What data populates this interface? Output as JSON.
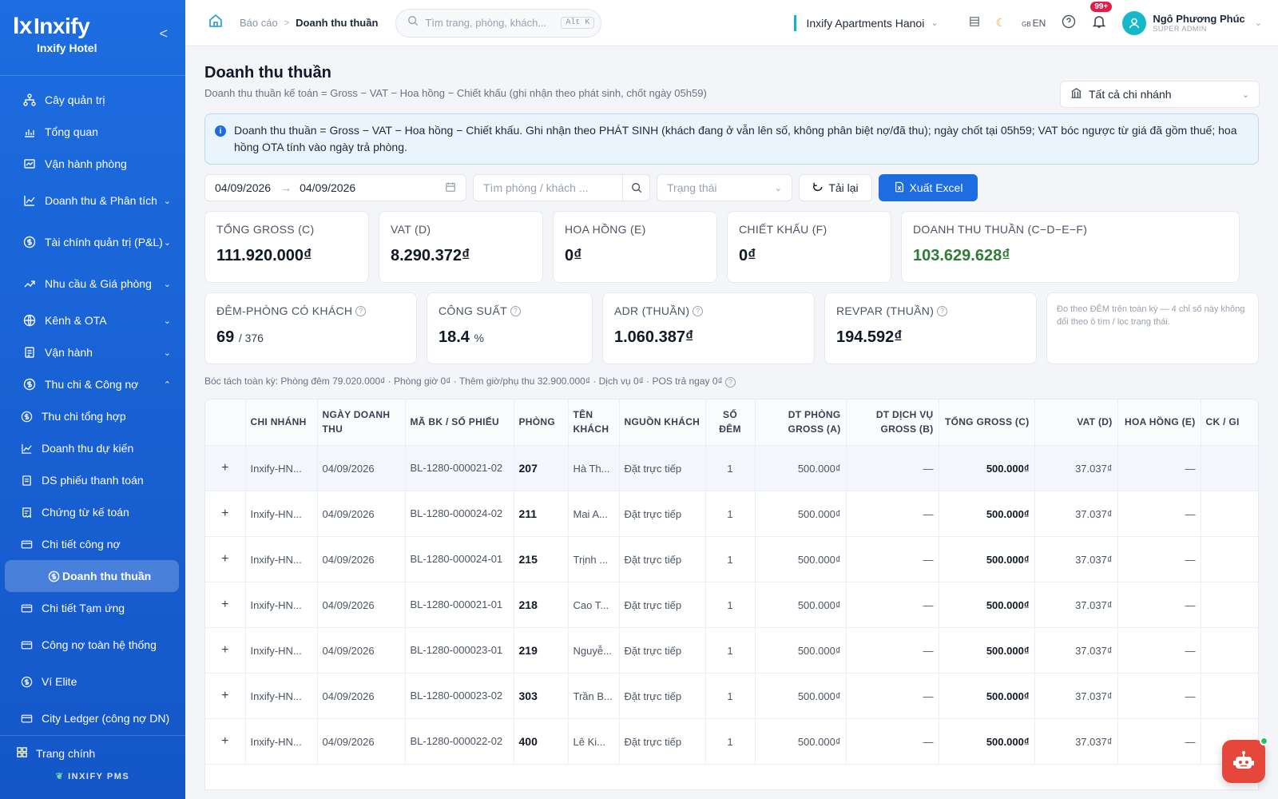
{
  "brand": {
    "name": "Inxify",
    "hotel": "Inxify Hotel",
    "footer": "INXIFY PMS"
  },
  "sidebar": {
    "items": [
      {
        "label": "Cây quản trị",
        "icon": "tree-icon"
      },
      {
        "label": "Tổng quan",
        "icon": "bar-chart-icon"
      },
      {
        "label": "Vận hành phòng",
        "icon": "window-icon"
      },
      {
        "label": "Doanh thu & Phân tích",
        "icon": "line-chart-icon"
      },
      {
        "label": "Tài chính quản trị (P&L)",
        "icon": "dollar-icon"
      },
      {
        "label": "Nhu cầu & Giá phòng",
        "icon": "trend-icon"
      },
      {
        "label": "Kênh & OTA",
        "icon": "globe-icon"
      },
      {
        "label": "Vận hành",
        "icon": "clipboard-icon"
      },
      {
        "label": "Thu chi & Công nợ",
        "icon": "dollar-icon"
      }
    ],
    "subitems": [
      {
        "label": "Thu chi tổng hợp"
      },
      {
        "label": "Doanh thu dự kiến"
      },
      {
        "label": "DS phiếu thanh toán"
      },
      {
        "label": "Chứng từ kế toán"
      },
      {
        "label": "Chi tiết công nợ"
      },
      {
        "label": "Doanh thu thuần"
      },
      {
        "label": "Chi tiết Tạm ứng"
      },
      {
        "label": "Công nợ toàn hệ thống"
      },
      {
        "label": "Ví Elite"
      },
      {
        "label": "City Ledger (công nợ DN)"
      }
    ],
    "home": "Trang chính"
  },
  "topbar": {
    "breadcrumb_parent": "Báo cáo",
    "breadcrumb_current": "Doanh thu thuần",
    "search_placeholder": "Tìm trang, phòng, khách...",
    "search_shortcut": "Alt K",
    "property": "Inxify Apartments Hanoi",
    "lang_flag": "GB",
    "lang": "EN",
    "notif_count": "99+",
    "user_name": "Ngô Phương Phúc",
    "user_role": "SUPER ADMIN"
  },
  "page": {
    "title": "Doanh thu thuần",
    "subtitle": "Doanh thu thuần kế toán = Gross − VAT − Hoa hồng − Chiết khấu (ghi nhận theo phát sinh, chốt ngày 05h59)",
    "branch_filter": "Tất cả chi nhánh",
    "info": "Doanh thu thuần = Gross − VAT − Hoa hồng − Chiết khấu. Ghi nhận theo PHÁT SINH (khách đang ở vẫn lên số, không phân biệt nợ/đã thu); ngày chốt tại 05h59; VAT bóc ngược từ giá đã gồm thuế; hoa hồng OTA tính vào ngày trả phòng."
  },
  "filters": {
    "date_from": "04/09/2026",
    "date_to": "04/09/2026",
    "search_placeholder": "Tìm phòng / khách ...",
    "status_placeholder": "Trạng thái",
    "reload": "Tải lại",
    "export": "Xuất Excel"
  },
  "kpi_row1": [
    {
      "label": "TỔNG GROSS (C)",
      "value": "111.920.000₫"
    },
    {
      "label": "VAT (D)",
      "value": "8.290.372₫"
    },
    {
      "label": "HOA HỒNG (E)",
      "value": "0₫"
    },
    {
      "label": "CHIẾT KHẤU (F)",
      "value": "0₫"
    },
    {
      "label": "DOANH THU THUẦN (C−D−E−F)",
      "value": "103.629.628₫"
    }
  ],
  "kpi_row2": [
    {
      "label": "ĐÊM-PHÒNG CÓ KHÁCH",
      "value": "69",
      "suffix": "/ 376"
    },
    {
      "label": "CÔNG SUẤT",
      "value": "18.4",
      "suffix": "%"
    },
    {
      "label": "ADR (THUẦN)",
      "value": "1.060.387₫",
      "suffix": ""
    },
    {
      "label": "REVPAR (THUẦN)",
      "value": "194.592₫",
      "suffix": ""
    }
  ],
  "kpi_note": "Đo theo ĐÊM trên toàn kỳ — 4 chỉ số này không đổi theo ô tìm / lọc trạng thái.",
  "breakdown": "Bóc tách toàn kỳ: Phòng đêm 79.020.000₫ · Phòng giờ 0₫ · Thêm giờ/phụ thu 32.900.000₫ · Dịch vụ 0₫ · POS trả ngay 0₫",
  "table": {
    "headers": [
      "CHI NHÁNH",
      "NGÀY DOANH THU",
      "MÃ BK / SỐ PHIẾU",
      "PHÒNG",
      "TÊN KHÁCH",
      "NGUỒN KHÁCH",
      "SỐ ĐÊM",
      "DT PHÒNG GROSS (A)",
      "DT DỊCH VỤ GROSS (B)",
      "TỔNG GROSS (C)",
      "VAT (D)",
      "HOA HỒNG (E)",
      "CK / GI"
    ],
    "rows": [
      {
        "branch": "Inxify-HN...",
        "date": "04/09/2026",
        "bk": "BL-1280-000021-02",
        "room": "207",
        "guest": "Hà Th...",
        "source": "Đặt trực tiếp",
        "nights": "1",
        "room_gross": "500.000₫",
        "svc_gross": "—",
        "total": "500.000₫",
        "vat": "37.037₫",
        "comm": "—"
      },
      {
        "branch": "Inxify-HN...",
        "date": "04/09/2026",
        "bk": "BL-1280-000024-02",
        "room": "211",
        "guest": "Mai A...",
        "source": "Đặt trực tiếp",
        "nights": "1",
        "room_gross": "500.000₫",
        "svc_gross": "—",
        "total": "500.000₫",
        "vat": "37.037₫",
        "comm": "—"
      },
      {
        "branch": "Inxify-HN...",
        "date": "04/09/2026",
        "bk": "BL-1280-000024-01",
        "room": "215",
        "guest": "Trịnh ...",
        "source": "Đặt trực tiếp",
        "nights": "1",
        "room_gross": "500.000₫",
        "svc_gross": "—",
        "total": "500.000₫",
        "vat": "37.037₫",
        "comm": "—"
      },
      {
        "branch": "Inxify-HN...",
        "date": "04/09/2026",
        "bk": "BL-1280-000021-01",
        "room": "218",
        "guest": "Cao T...",
        "source": "Đặt trực tiếp",
        "nights": "1",
        "room_gross": "500.000₫",
        "svc_gross": "—",
        "total": "500.000₫",
        "vat": "37.037₫",
        "comm": "—"
      },
      {
        "branch": "Inxify-HN...",
        "date": "04/09/2026",
        "bk": "BL-1280-000023-01",
        "room": "219",
        "guest": "Nguyễ...",
        "source": "Đặt trực tiếp",
        "nights": "1",
        "room_gross": "500.000₫",
        "svc_gross": "—",
        "total": "500.000₫",
        "vat": "37.037₫",
        "comm": "—"
      },
      {
        "branch": "Inxify-HN...",
        "date": "04/09/2026",
        "bk": "BL-1280-000023-02",
        "room": "303",
        "guest": "Trần B...",
        "source": "Đặt trực tiếp",
        "nights": "1",
        "room_gross": "500.000₫",
        "svc_gross": "—",
        "total": "500.000₫",
        "vat": "37.037₫",
        "comm": "—"
      },
      {
        "branch": "Inxify-HN...",
        "date": "04/09/2026",
        "bk": "BL-1280-000022-02",
        "room": "400",
        "guest": "Lê Ki...",
        "source": "Đặt trực tiếp",
        "nights": "1",
        "room_gross": "500.000₫",
        "svc_gross": "—",
        "total": "500.000₫",
        "vat": "37.037₫",
        "comm": "—"
      }
    ]
  }
}
